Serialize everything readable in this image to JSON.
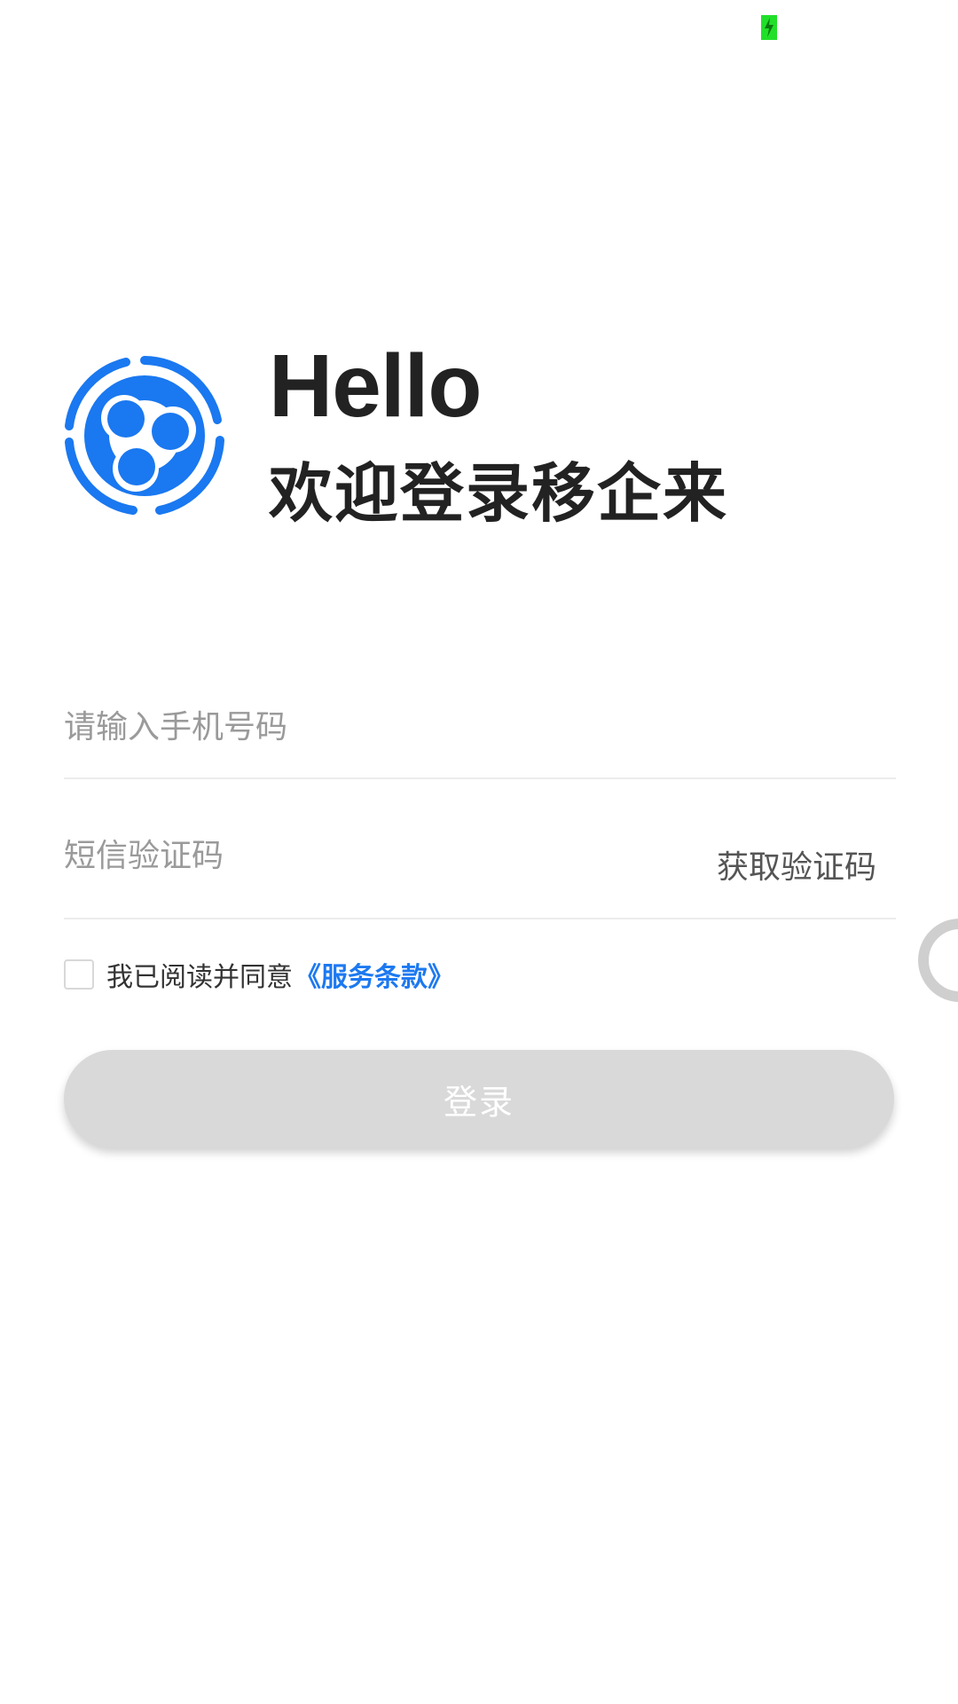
{
  "status_bar": {
    "battery_icon": "battery-charging-icon",
    "battery_color": "#22e02a"
  },
  "header": {
    "logo_icon": "app-logo-icon",
    "greeting": "Hello",
    "welcome": "欢迎登录移企来"
  },
  "form": {
    "phone_placeholder": "请输入手机号码",
    "phone_value": "",
    "code_placeholder": "短信验证码",
    "code_value": "",
    "get_code_label": "获取验证码"
  },
  "agreement": {
    "checked": false,
    "text": "我已阅读并同意",
    "link_text": "《服务条款》"
  },
  "login": {
    "label": "登录"
  },
  "colors": {
    "accent": "#1d79f0",
    "brand_logo": "#1a78f0",
    "disabled_button": "#d9d9d9"
  }
}
